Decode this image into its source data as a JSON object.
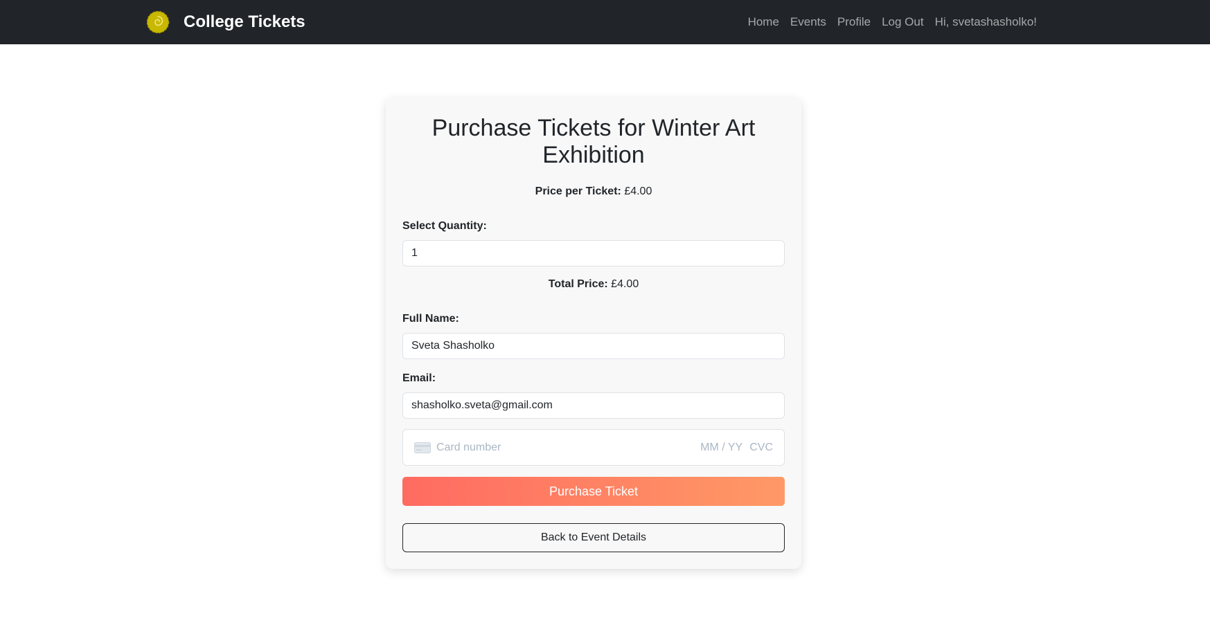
{
  "navbar": {
    "brand": "College Tickets",
    "logo_icon": "college-logo-icon",
    "links": [
      "Home",
      "Events",
      "Profile",
      "Log Out"
    ],
    "greeting": "Hi, svetashasholko!"
  },
  "purchase": {
    "title": "Purchase Tickets for Winter Art Exhibition",
    "price_label": "Price per Ticket:",
    "price_value": "£4.00",
    "quantity_label": "Select Quantity:",
    "quantity_value": "1",
    "total_label": "Total Price:",
    "total_value": "£4.00",
    "name_label": "Full Name:",
    "name_value": "Sveta Shasholko",
    "email_label": "Email:",
    "email_value": "shasholko.sveta@gmail.com",
    "card": {
      "icon": "credit-card-icon",
      "number_placeholder": "Card number",
      "expiry_placeholder": "MM / YY",
      "cvc_placeholder": "CVC"
    },
    "purchase_button": "Purchase Ticket",
    "back_button": "Back to Event Details"
  },
  "colors": {
    "navbar_bg": "#212529",
    "logo": "#c8b800",
    "button_gradient_start": "#ff6b61",
    "button_gradient_end": "#ff9966"
  }
}
